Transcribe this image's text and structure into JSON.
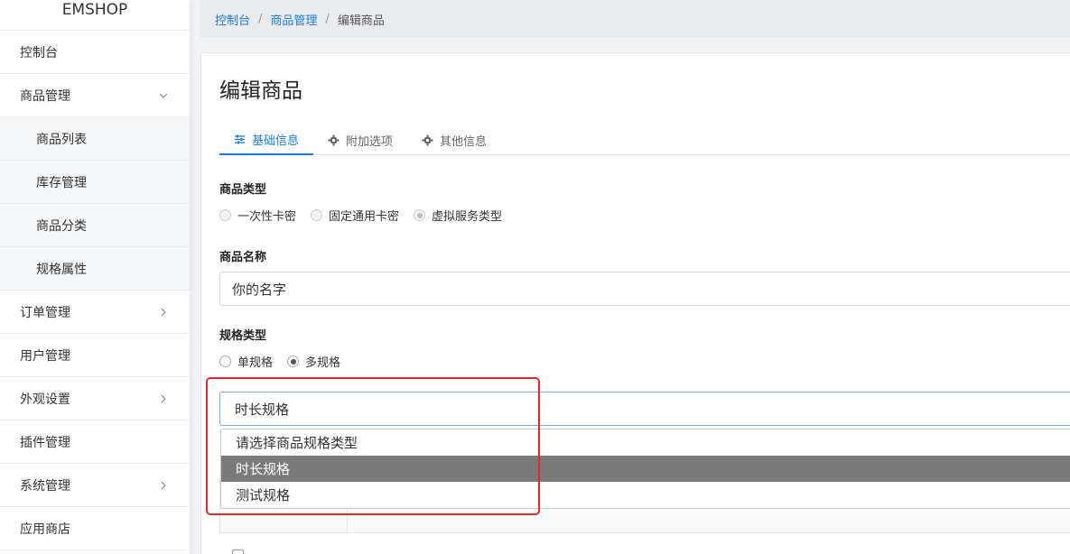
{
  "brand": "EMSHOP",
  "sidebar": {
    "items": [
      {
        "label": "控制台"
      },
      {
        "label": "商品管理"
      },
      {
        "label": "商品列表"
      },
      {
        "label": "库存管理"
      },
      {
        "label": "商品分类"
      },
      {
        "label": "规格属性"
      },
      {
        "label": "订单管理"
      },
      {
        "label": "用户管理"
      },
      {
        "label": "外观设置"
      },
      {
        "label": "插件管理"
      },
      {
        "label": "系统管理"
      },
      {
        "label": "应用商店"
      }
    ]
  },
  "breadcrumb": {
    "items": [
      "控制台",
      "商品管理",
      "编辑商品"
    ],
    "separator": "/"
  },
  "page": {
    "title": "编辑商品",
    "tabs": [
      {
        "label": "基础信息",
        "icon": "sliders-icon",
        "active": true
      },
      {
        "label": "附加选项",
        "icon": "gear-icon"
      },
      {
        "label": "其他信息",
        "icon": "gear-icon"
      }
    ]
  },
  "form": {
    "product_type": {
      "label": "商品类型",
      "options": [
        "一次性卡密",
        "固定通用卡密",
        "虚拟服务类型"
      ],
      "selected": "虚拟服务类型"
    },
    "product_name": {
      "label": "商品名称",
      "value": "你的名字"
    },
    "spec_type": {
      "label": "规格类型",
      "options": [
        "单规格",
        "多规格"
      ],
      "selected": "多规格"
    },
    "spec_select": {
      "value": "时长规格",
      "options": [
        "请选择商品规格类型",
        "时长规格",
        "测试规格"
      ],
      "highlighted": "时长规格"
    }
  },
  "colors": {
    "accent": "#1d7bd8",
    "highlight_box": "#e02a2a",
    "dropdown_selected_bg": "#7a7a7a"
  }
}
